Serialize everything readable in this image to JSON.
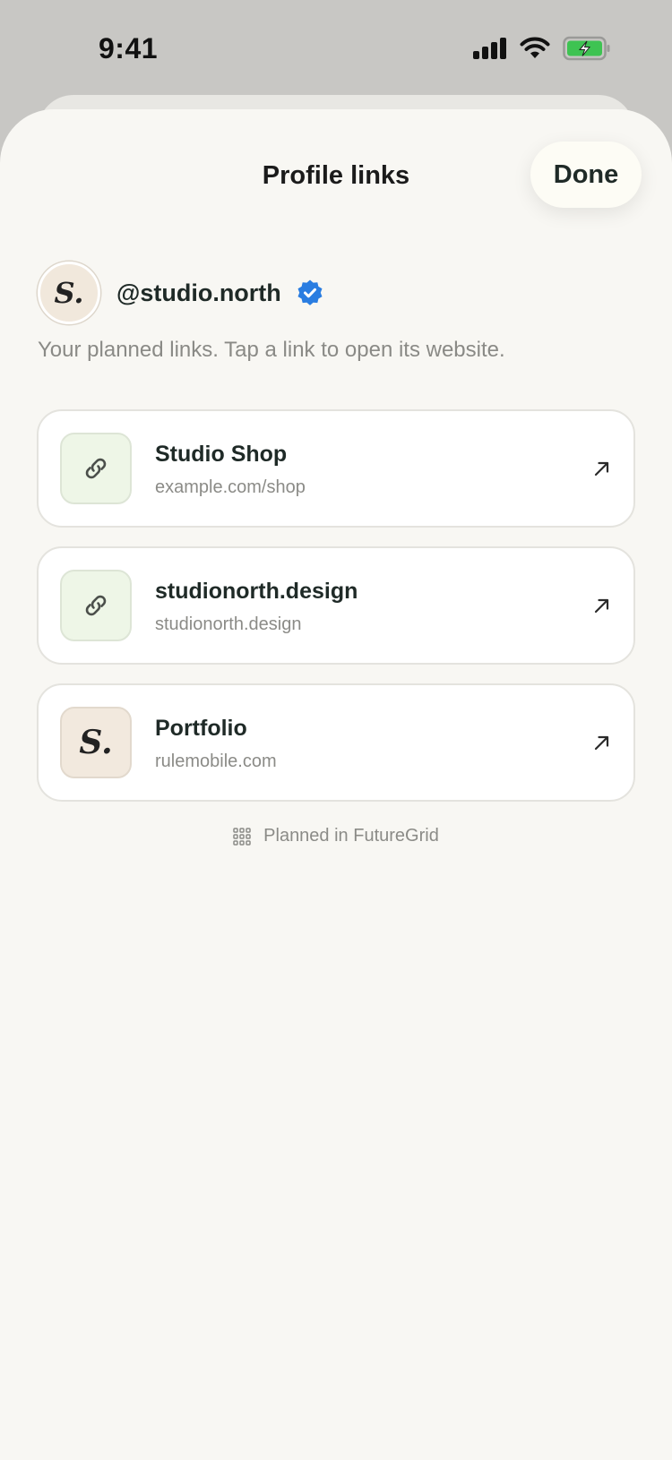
{
  "status_bar": {
    "time": "9:41",
    "icons": [
      "signal-icon",
      "wifi-icon",
      "battery-charging-icon"
    ]
  },
  "sheet": {
    "title": "Profile links",
    "done_label": "Done"
  },
  "profile": {
    "avatar_text": "S.",
    "handle": "@studio.north",
    "verified": true
  },
  "subtitle": "Your planned links. Tap a link to open its website.",
  "links": [
    {
      "title": "Studio Shop",
      "url": "example.com/shop",
      "icon": "link-icon"
    },
    {
      "title": "studionorth.design",
      "url": "studionorth.design",
      "icon": "link-icon"
    },
    {
      "title": "Portfolio",
      "url": "rulemobile.com",
      "icon": "S."
    }
  ],
  "footer": {
    "text": "Planned in FutureGrid",
    "icon": "grid-icon"
  },
  "colors": {
    "background": "#c8c7c4",
    "sheet": "#f8f7f3",
    "verified_blue": "#2a7de1",
    "battery_green": "#3ec352"
  }
}
